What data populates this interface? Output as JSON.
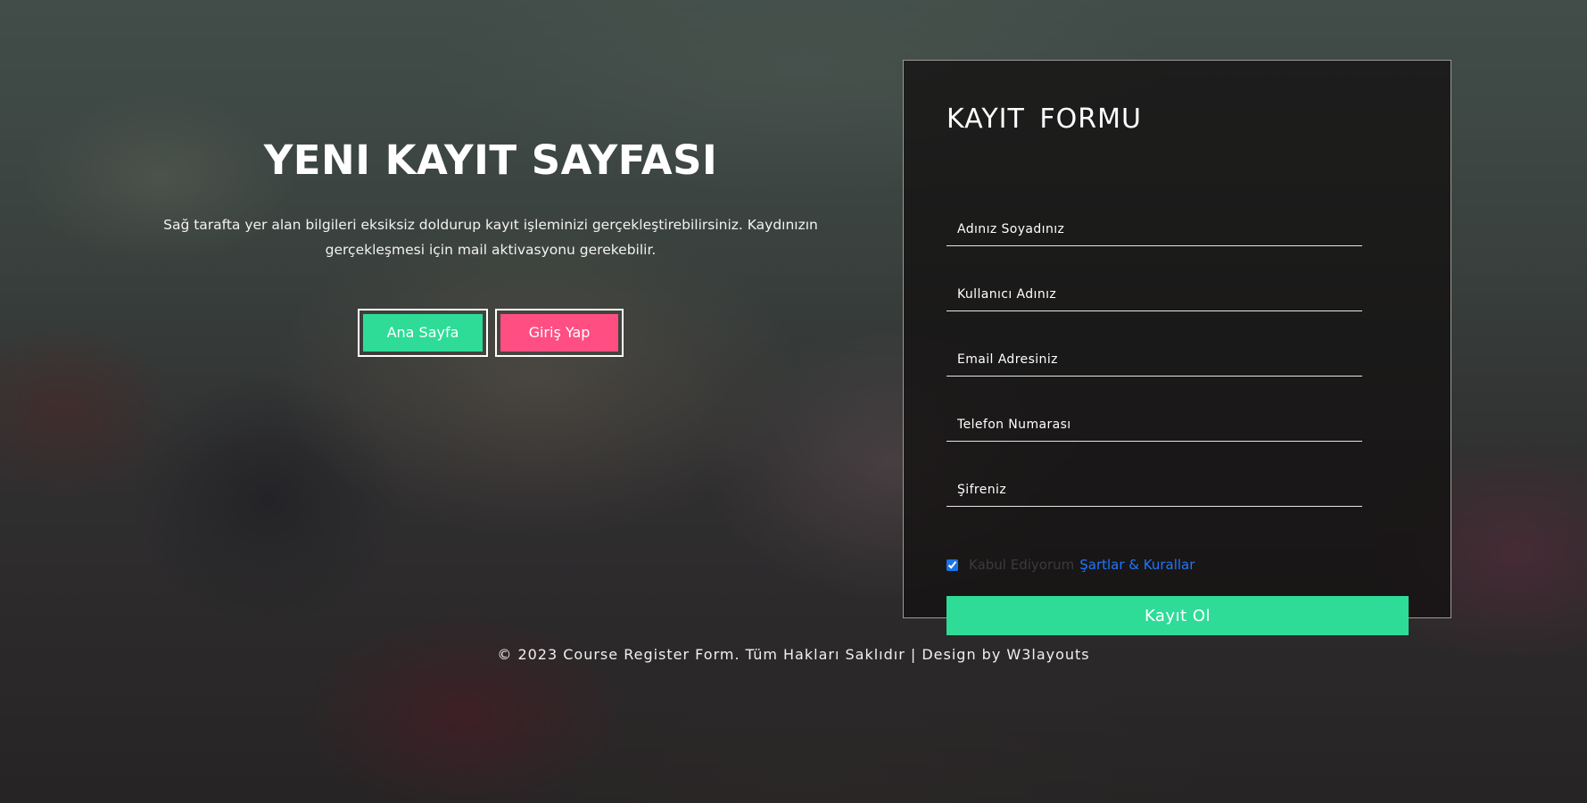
{
  "hero": {
    "title": "YENI KAYIT SAYFASI",
    "description": "Sağ tarafta yer alan bilgileri eksiksiz doldurup kayıt işleminizi gerçekleştirebilirsiniz. Kaydınızın gerçekleşmesi için mail aktivasyonu gerekebilir.",
    "home_button": "Ana Sayfa",
    "login_button": "Giriş Yap"
  },
  "form": {
    "title": "KAYIT  FORMU",
    "fields": [
      {
        "placeholder": "Adınız Soyadınız",
        "value": ""
      },
      {
        "placeholder": "Kullanıcı Adınız",
        "value": ""
      },
      {
        "placeholder": "Email Adresiniz",
        "value": ""
      },
      {
        "placeholder": "Telefon Numarası",
        "value": ""
      },
      {
        "placeholder": "Şifreniz",
        "value": ""
      }
    ],
    "terms_checked": true,
    "terms_text": "Kabul Ediyorum",
    "terms_link": "Şartlar & Kurallar",
    "submit_label": "Kayıt Ol"
  },
  "footer": {
    "text": "© 2023 Course Register Form. Tüm Hakları Saklıdır | Design by W3layouts"
  },
  "colors": {
    "accent_green": "#2edc97",
    "accent_pink": "#ff4f82",
    "link_blue": "#1f77ff"
  }
}
